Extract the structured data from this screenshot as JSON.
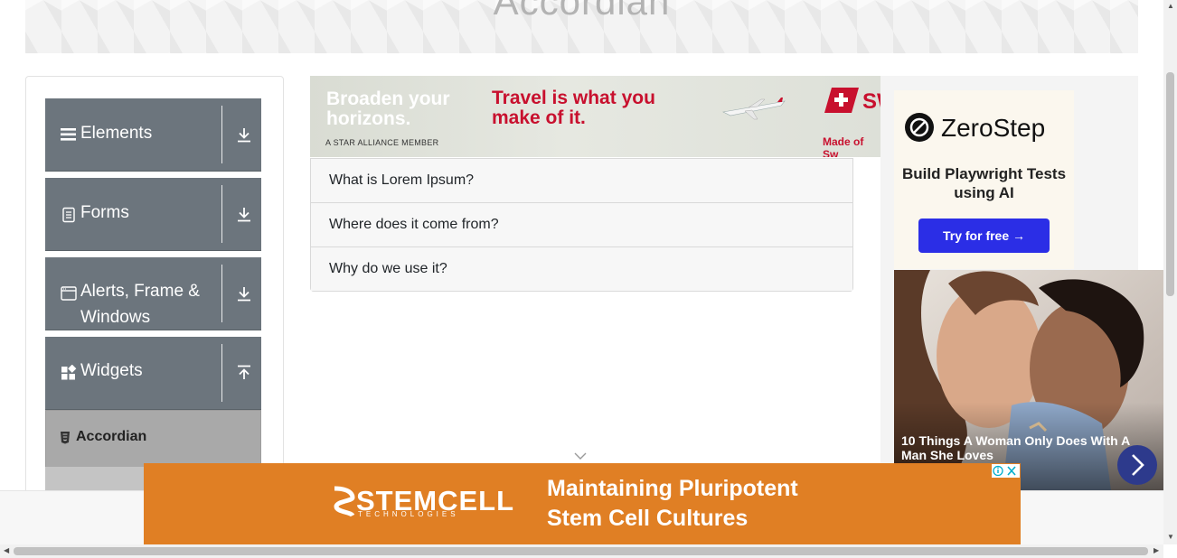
{
  "header": {
    "title": "Accordian"
  },
  "sidebar": {
    "groups": [
      {
        "label": "Elements",
        "icon": "hamburger-icon",
        "expanded": false
      },
      {
        "label": "Forms",
        "icon": "document-icon",
        "expanded": false
      },
      {
        "label": "Alerts, Frame & Windows",
        "icon": "window-icon",
        "expanded": false
      },
      {
        "label": "Widgets",
        "icon": "widgets-icon",
        "expanded": true
      }
    ],
    "active_item": {
      "label": "Accordian",
      "icon": "html5-icon"
    }
  },
  "ad_top": {
    "line1": "Broaden your horizons.",
    "line2": "Travel is what you make of it.",
    "line3": "A STAR ALLIANCE MEMBER",
    "line4": "Made of Sw"
  },
  "accordion": {
    "items": [
      {
        "label": "What is Lorem Ipsum?"
      },
      {
        "label": "Where does it come from?"
      },
      {
        "label": "Why do we use it?"
      }
    ]
  },
  "ad_right": {
    "brand": "ZeroStep",
    "tagline": "Build Playwright Tests using AI",
    "button": "Try for free →",
    "photo_caption": "10 Things A Woman Only Does With A Man She Loves"
  },
  "ad_bottom": {
    "brand": "STEMCELL",
    "brand_sub": "TECHNOLOGIES",
    "message": "Maintaining Pluripotent Stem Cell Cultures"
  },
  "colors": {
    "sidebar_group": "#6c757d",
    "active_item": "#a9a9a9",
    "ad_bottom": "#e07f24",
    "zerostep_button": "#2b2ee6",
    "swiss_red": "#c8102e"
  }
}
